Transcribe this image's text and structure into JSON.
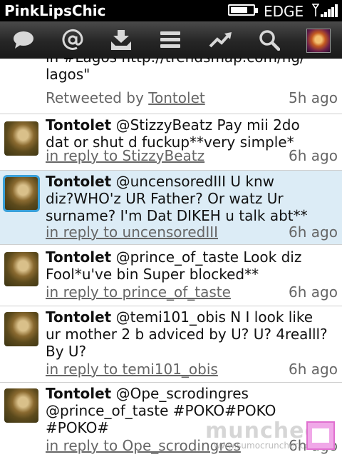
{
  "status_bar": {
    "carrier": "PinkLipsChic",
    "network": "EDGE",
    "battery_level": 0.75,
    "signal_bars": 5
  },
  "toolbar": {
    "buttons": [
      {
        "icon": "speech-bubble-icon"
      },
      {
        "icon": "at-sign-icon"
      },
      {
        "icon": "inbox-download-icon"
      },
      {
        "icon": "list-icon"
      },
      {
        "icon": "trending-icon"
      },
      {
        "icon": "search-icon"
      },
      {
        "icon": "profile-avatar"
      }
    ]
  },
  "feed": {
    "partial": {
      "text_line1": "in #Lagos http://trendsmap.com/ng/",
      "text_line2": "lagos\"",
      "retweet_prefix": "Retweeted by",
      "retweeter": "Tontolet",
      "time": "5h ago"
    },
    "tweets": [
      {
        "author": "Tontolet",
        "lines": [
          "@StizzyBeatz Pay mii 2do",
          "dat or shut d fuckup**very simple*"
        ],
        "reply": "in reply to StizzyBeatz",
        "time": "6h ago",
        "selected": false
      },
      {
        "author": "Tontolet",
        "lines": [
          "@uncensoredIII U knw",
          "diz?WHO'z UR Father? Or watz Ur",
          "surname? I'm Dat DIKEH u talk abt**"
        ],
        "reply": "in reply to uncensoredIII",
        "time": "6h ago",
        "selected": true
      },
      {
        "author": "Tontolet",
        "lines": [
          "@prince_of_taste Look diz",
          "Fool*u've bin Super blocked**"
        ],
        "reply": "in reply to prince_of_taste",
        "time": "6h ago",
        "selected": false
      },
      {
        "author": "Tontolet",
        "lines": [
          "@temi101_obis N I look like",
          "ur mother 2 b adviced by U? U? 4realll?",
          "By U?"
        ],
        "reply": "in reply to temi101_obis",
        "time": "6h ago",
        "selected": false
      },
      {
        "author": "Tontolet",
        "lines": [
          "@Ope_scrodingres",
          "@prince_of_taste #POKO#POKO",
          "#POKO#"
        ],
        "reply": "in reply to Ope_scrodingres",
        "time": "6h ago",
        "selected": false
      }
    ]
  },
  "watermark": {
    "brand": "munched",
    "sub": "www.sumocruncher.com"
  },
  "colors": {
    "selected_background": "#dcecf6",
    "selected_outline": "#3aa0d8",
    "meta_text": "#666666"
  }
}
